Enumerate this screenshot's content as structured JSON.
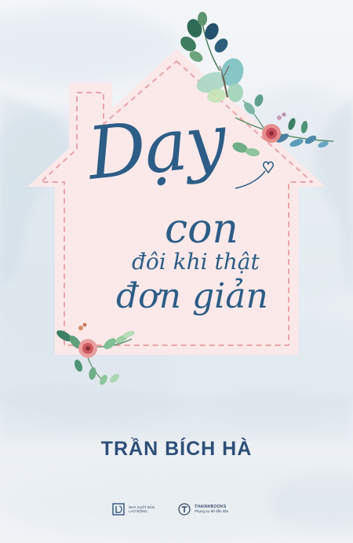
{
  "book": {
    "title": {
      "line1": "Dạy",
      "line2": "con",
      "line3": "đôi khi thật",
      "line4": "đơn giản"
    },
    "author": "TRẦN BÍCH HÀ"
  },
  "publishers": {
    "left": {
      "name_line1": "NHÀ XUẤT BẢN",
      "name_line2": "LAO ĐỘNG"
    },
    "right": {
      "name": "THAINHBOOKS",
      "tagline": "Phụng sự để dẫn đầu"
    }
  },
  "colors": {
    "title": "#2c5d86",
    "author": "#2e4f78",
    "house_fill": "#fbe9ea",
    "house_dash": "#e9a4a6"
  }
}
